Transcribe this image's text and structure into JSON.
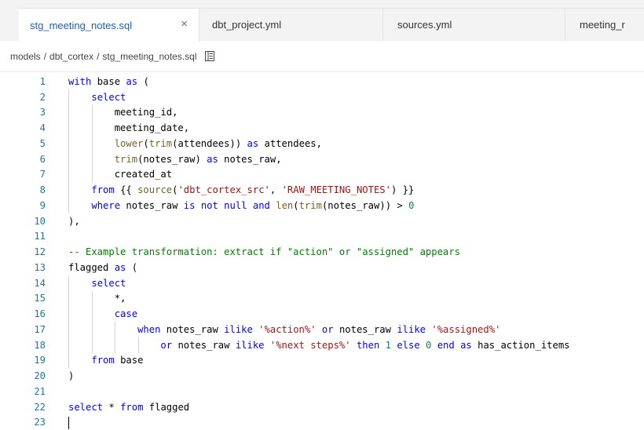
{
  "tabs": [
    {
      "label": "stg_meeting_notes.sql",
      "active": true,
      "close_glyph": "×"
    },
    {
      "label": "dbt_project.yml",
      "active": false
    },
    {
      "label": "sources.yml",
      "active": false
    },
    {
      "label": "meeting_r",
      "active": false
    }
  ],
  "breadcrumb": {
    "parts": [
      "models",
      "dbt_cortex",
      "stg_meeting_notes.sql"
    ],
    "separator": "/",
    "icon": "outline-list-icon"
  },
  "editor": {
    "language": "sql",
    "line_numbers": [
      "1",
      "2",
      "3",
      "4",
      "5",
      "6",
      "7",
      "8",
      "9",
      "10",
      "11",
      "12",
      "13",
      "14",
      "15",
      "16",
      "17",
      "18",
      "19",
      "20",
      "21",
      "22",
      "23"
    ],
    "lines": [
      "with base as (",
      "    select",
      "        meeting_id,",
      "        meeting_date,",
      "        lower(trim(attendees)) as attendees,",
      "        trim(notes_raw) as notes_raw,",
      "        created_at",
      "    from {{ source('dbt_cortex_src', 'RAW_MEETING_NOTES') }}",
      "    where notes_raw is not null and len(trim(notes_raw)) > 0",
      "),",
      "",
      "-- Example transformation: extract if \"action\" or \"assigned\" appears",
      "flagged as (",
      "    select",
      "        *,",
      "        case",
      "            when notes_raw ilike '%action%' or notes_raw ilike '%assigned%'",
      "                or notes_raw ilike '%next steps%' then 1 else 0 end as has_action_items",
      "    from base",
      ")",
      "",
      "select * from flagged",
      ""
    ]
  },
  "colors": {
    "keyword": "#0000ff",
    "function": "#795e26",
    "string": "#a31515",
    "number": "#098658",
    "comment": "#008000",
    "line_number": "#237893",
    "active_tab_text": "#1a5fb4"
  }
}
